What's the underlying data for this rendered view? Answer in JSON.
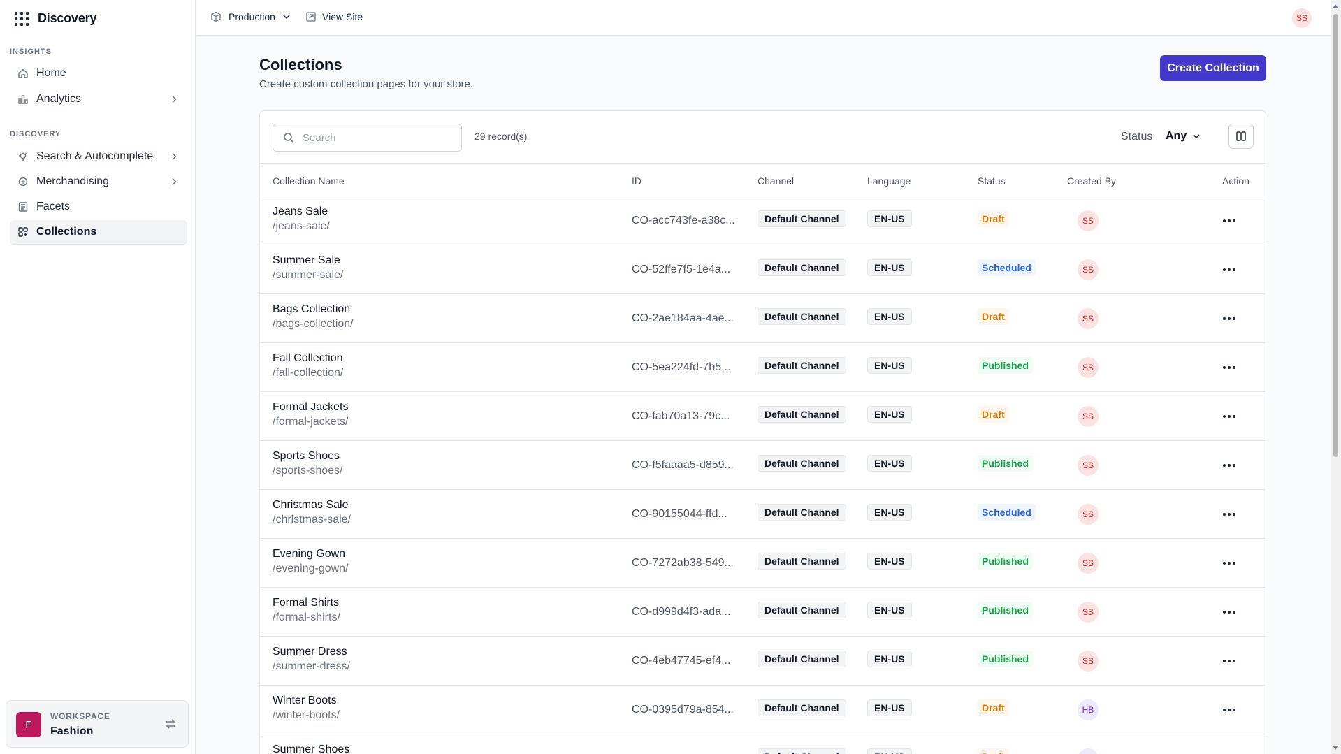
{
  "app": {
    "title": "Discovery"
  },
  "sidebar": {
    "insights_label": "INSIGHTS",
    "discovery_label": "DISCOVERY",
    "items": [
      {
        "label": "Home",
        "icon": "home-icon"
      },
      {
        "label": "Analytics",
        "icon": "analytics-icon"
      },
      {
        "label": "Search & Autocomplete",
        "icon": "bulb-icon"
      },
      {
        "label": "Merchandising",
        "icon": "merchandising-icon"
      },
      {
        "label": "Facets",
        "icon": "facets-icon"
      },
      {
        "label": "Collections",
        "icon": "collections-icon",
        "active": true
      }
    ],
    "workspace": {
      "label": "WORKSPACE",
      "name": "Fashion",
      "initial": "F"
    }
  },
  "topbar": {
    "environment": "Production",
    "view_site": "View Site",
    "avatar": "SS"
  },
  "page": {
    "title": "Collections",
    "subtitle": "Create custom collection pages for your store.",
    "create_button": "Create Collection"
  },
  "toolbar": {
    "search_placeholder": "Search",
    "records": "29 record(s)",
    "status_label": "Status",
    "status_value": "Any"
  },
  "table": {
    "headers": {
      "name": "Collection Name",
      "id": "ID",
      "channel": "Channel",
      "language": "Language",
      "status": "Status",
      "created_by": "Created By",
      "action": "Action"
    },
    "rows": [
      {
        "name": "Jeans Sale",
        "path": "/jeans-sale/",
        "id": "CO-acc743fe-a38c...",
        "channel": "Default Channel",
        "language": "EN-US",
        "status": "Draft",
        "created_by": "SS"
      },
      {
        "name": "Summer Sale",
        "path": "/summer-sale/",
        "id": "CO-52ffe7f5-1e4a...",
        "channel": "Default Channel",
        "language": "EN-US",
        "status": "Scheduled",
        "created_by": "SS"
      },
      {
        "name": "Bags Collection",
        "path": "/bags-collection/",
        "id": "CO-2ae184aa-4ae...",
        "channel": "Default Channel",
        "language": "EN-US",
        "status": "Draft",
        "created_by": "SS"
      },
      {
        "name": "Fall Collection",
        "path": "/fall-collection/",
        "id": "CO-5ea224fd-7b5...",
        "channel": "Default Channel",
        "language": "EN-US",
        "status": "Published",
        "created_by": "SS"
      },
      {
        "name": "Formal Jackets",
        "path": "/formal-jackets/",
        "id": "CO-fab70a13-79c...",
        "channel": "Default Channel",
        "language": "EN-US",
        "status": "Draft",
        "created_by": "SS"
      },
      {
        "name": "Sports Shoes",
        "path": "/sports-shoes/",
        "id": "CO-f5faaaa5-d859...",
        "channel": "Default Channel",
        "language": "EN-US",
        "status": "Published",
        "created_by": "SS"
      },
      {
        "name": "Christmas Sale",
        "path": "/christmas-sale/",
        "id": "CO-90155044-ffd...",
        "channel": "Default Channel",
        "language": "EN-US",
        "status": "Scheduled",
        "created_by": "SS"
      },
      {
        "name": "Evening Gown",
        "path": "/evening-gown/",
        "id": "CO-7272ab38-549...",
        "channel": "Default Channel",
        "language": "EN-US",
        "status": "Published",
        "created_by": "SS"
      },
      {
        "name": "Formal Shirts",
        "path": "/formal-shirts/",
        "id": "CO-d999d4f3-ada...",
        "channel": "Default Channel",
        "language": "EN-US",
        "status": "Published",
        "created_by": "SS"
      },
      {
        "name": "Summer Dress",
        "path": "/summer-dress/",
        "id": "CO-4eb47745-ef4...",
        "channel": "Default Channel",
        "language": "EN-US",
        "status": "Published",
        "created_by": "SS"
      },
      {
        "name": "Winter Boots",
        "path": "/winter-boots/",
        "id": "CO-0395d79a-854...",
        "channel": "Default Channel",
        "language": "EN-US",
        "status": "Draft",
        "created_by": "HB"
      },
      {
        "name": "Summer Shoes",
        "path": "",
        "id": "",
        "channel": "Default Channel",
        "language": "EN-US",
        "status": "Draft",
        "created_by": "HB"
      }
    ]
  },
  "colors": {
    "primary": "#4338ca",
    "draft": "#d97706",
    "scheduled": "#2563eb",
    "published": "#16a34a"
  }
}
